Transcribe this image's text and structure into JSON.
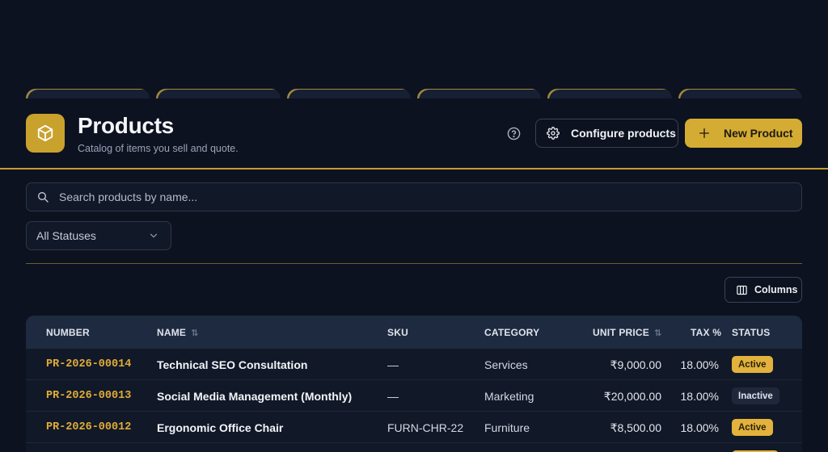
{
  "header": {
    "title": "Products",
    "subtitle": "Catalog of items you sell and quote.",
    "configure_label": "Configure products",
    "new_label": "New Product"
  },
  "search": {
    "placeholder": "Search products by name..."
  },
  "filters": {
    "status_selected": "All Statuses"
  },
  "toolbar": {
    "columns_label": "Columns"
  },
  "table": {
    "headers": {
      "number": "NUMBER",
      "name": "NAME",
      "sku": "SKU",
      "category": "CATEGORY",
      "unit_price": "UNIT PRICE",
      "tax": "TAX %",
      "status": "STATUS"
    },
    "rows": [
      {
        "number": "PR-2026-00014",
        "name": "Technical SEO Consultation",
        "sku": "—",
        "category": "Services",
        "unit_price": "₹9,000.00",
        "tax": "18.00%",
        "status": "Active"
      },
      {
        "number": "PR-2026-00013",
        "name": "Social Media Management (Monthly)",
        "sku": "—",
        "category": "Marketing",
        "unit_price": "₹20,000.00",
        "tax": "18.00%",
        "status": "Inactive"
      },
      {
        "number": "PR-2026-00012",
        "name": "Ergonomic Office Chair",
        "sku": "FURN-CHR-22",
        "category": "Furniture",
        "unit_price": "₹8,500.00",
        "tax": "18.00%",
        "status": "Active"
      }
    ]
  },
  "colors": {
    "accent": "#d4ac33",
    "background": "#0d1220",
    "active_badge": "#e3b23c",
    "inactive_badge": "#1f283b"
  },
  "icons": {
    "logo": "box-icon",
    "help": "help-circle-icon",
    "configure": "gear-icon",
    "new": "plus-icon",
    "search": "search-icon",
    "select": "chevron-down-icon",
    "columns": "columns-icon",
    "sort": "sort-arrows-icon"
  }
}
